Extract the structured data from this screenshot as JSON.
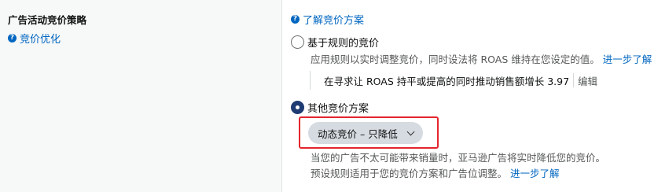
{
  "left": {
    "section_title": "广告活动竞价策略",
    "help_link": "竞价优化"
  },
  "right": {
    "help_link": "了解竞价方案",
    "rule_option": {
      "label": "基于规则的竞价",
      "selected": false,
      "description": "应用规则以实时调整竞价，同时设法将 ROAS 维持在您设定的值。",
      "learn_more": "进一步了解",
      "rule_text": "在寻求让 ROAS 持平或提高的同时推动销售额增长 3.97",
      "edit_label": "编辑"
    },
    "other_option": {
      "label": "其他竞价方案",
      "selected": true,
      "dropdown_value": "动态竞价 – 只降低",
      "description": "当您的广告不太可能带来销量时，亚马逊广告将实时降低您的竞价。预设规则适用于您的竞价方案和广告位调整。",
      "learn_more": "进一步了解"
    }
  },
  "colors": {
    "link": "#0066c0",
    "highlight": "#e3262d",
    "radio_selected": "#1f3b73",
    "dropdown_bg": "#d6dbe1"
  }
}
